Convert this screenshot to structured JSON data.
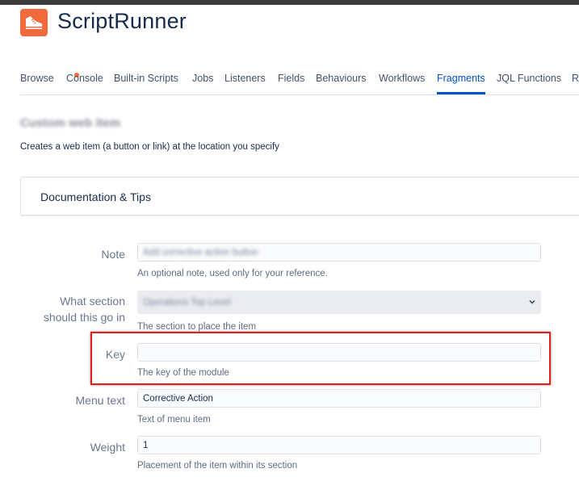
{
  "app": {
    "title": "ScriptRunner",
    "logo_icon": "sneaker-icon",
    "brand_color": "#f26a3c"
  },
  "nav": {
    "tabs": [
      {
        "label": "Browse",
        "badge": "orange-dot"
      },
      {
        "label": "Console"
      },
      {
        "label": "Built-in Scripts"
      },
      {
        "label": "Jobs"
      },
      {
        "label": "Listeners"
      },
      {
        "label": "Fields"
      },
      {
        "label": "Behaviours"
      },
      {
        "label": "Workflows"
      },
      {
        "label": "Fragments",
        "active": true
      },
      {
        "label": "JQL Functions"
      },
      {
        "label": "RE"
      }
    ],
    "active_color": "#0052cc"
  },
  "page": {
    "heading_blurred": "Custom web item",
    "subtitle": "Creates a web item (a button or link) at the location you specify"
  },
  "docs_panel": {
    "label": "Documentation & Tips"
  },
  "form": {
    "note": {
      "label": "Note",
      "value_blurred": "Add corrective action button",
      "help": "An optional note, used only for your reference."
    },
    "section": {
      "label_line1": "What section",
      "label_line2": "should this go in",
      "value_blurred": "Operations Top Level",
      "help": "The section to place the item"
    },
    "key": {
      "label": "Key",
      "value": "",
      "help": "The key of the module"
    },
    "menu_text": {
      "label": "Menu text",
      "value": "Corrective Action",
      "help": "Text of menu item"
    },
    "weight": {
      "label": "Weight",
      "value": "1",
      "help": "Placement of the item within its section"
    }
  },
  "annotation": {
    "highlight_color": "#e02020"
  }
}
